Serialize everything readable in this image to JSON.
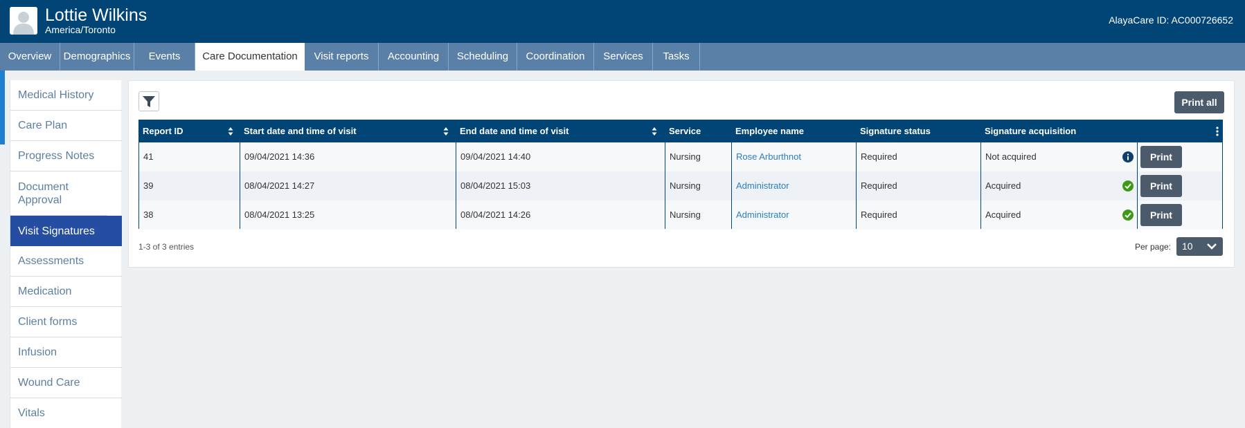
{
  "header": {
    "client_name": "Lottie Wilkins",
    "timezone": "America/Toronto",
    "alayacare_id": "AlayaCare ID: AC000726652"
  },
  "tabs": [
    {
      "label": "Overview"
    },
    {
      "label": "Demographics"
    },
    {
      "label": "Events"
    },
    {
      "label": "Care Documentation",
      "active": true
    },
    {
      "label": "Visit reports"
    },
    {
      "label": "Accounting"
    },
    {
      "label": "Scheduling"
    },
    {
      "label": "Coordination"
    },
    {
      "label": "Services"
    },
    {
      "label": "Tasks"
    }
  ],
  "sidebar": {
    "items": [
      {
        "label": "Medical History"
      },
      {
        "label": "Care Plan"
      },
      {
        "label": "Progress Notes"
      },
      {
        "label": "Document Approval"
      },
      {
        "label": "Visit Signatures",
        "active": true
      },
      {
        "label": "Assessments"
      },
      {
        "label": "Medication"
      },
      {
        "label": "Client forms"
      },
      {
        "label": "Infusion"
      },
      {
        "label": "Wound Care"
      },
      {
        "label": "Vitals"
      }
    ]
  },
  "toolbar": {
    "print_all_label": "Print all"
  },
  "table": {
    "columns": [
      "Report ID",
      "Start date and time of visit",
      "End date and time of visit",
      "Service",
      "Employee name",
      "Signature status",
      "Signature acquisition"
    ],
    "rows": [
      {
        "report_id": "41",
        "start": "09/04/2021 14:36",
        "end": "09/04/2021 14:40",
        "service": "Nursing",
        "employee": "Rose Arburthnot",
        "status": "Required",
        "acquisition": "Not acquired",
        "acq_icon": "info-icon",
        "print_label": "Print"
      },
      {
        "report_id": "39",
        "start": "08/04/2021 14:27",
        "end": "08/04/2021 15:03",
        "service": "Nursing",
        "employee": "Administrator",
        "status": "Required",
        "acquisition": "Acquired",
        "acq_icon": "check-circle-icon",
        "print_label": "Print"
      },
      {
        "report_id": "38",
        "start": "08/04/2021 13:25",
        "end": "08/04/2021 14:26",
        "service": "Nursing",
        "employee": "Administrator",
        "status": "Required",
        "acquisition": "Acquired",
        "acq_icon": "check-circle-icon",
        "print_label": "Print"
      }
    ]
  },
  "footer": {
    "entries_text": "1-3 of 3 entries",
    "per_page_label": "Per page:",
    "per_page_value": "10"
  },
  "colors": {
    "header_bg": "#004575",
    "tab_bg": "#5b80a8",
    "sidebar_active": "#254da1",
    "link": "#2a7fc0",
    "button": "#4b5b6b",
    "check_green": "#3e9a16",
    "info_navy": "#0d3f6e"
  }
}
